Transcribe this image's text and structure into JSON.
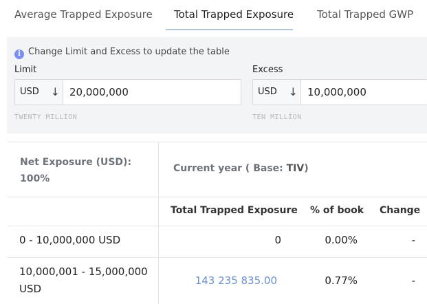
{
  "tabs": [
    {
      "label": "Average Trapped Exposure",
      "active": false
    },
    {
      "label": "Total Trapped Exposure",
      "active": true
    },
    {
      "label": "Total Trapped GWP",
      "active": false
    }
  ],
  "filters": {
    "info_text": "Change Limit and Excess to update the table",
    "info_icon": "info-icon",
    "limit": {
      "label": "Limit",
      "currency": "USD",
      "value": "20,000,000",
      "words": "TWENTY MILLION"
    },
    "excess": {
      "label": "Excess",
      "currency": "USD",
      "value": "10,000,000",
      "words": "TEN MILLION"
    }
  },
  "table": {
    "net_exposure_label": "Net Exposure (USD):",
    "net_exposure_pct": "100%",
    "current_year_prefix": "Current year ( Base: ",
    "current_year_base": "TIV",
    "current_year_suffix": ")",
    "columns": [
      "Total Trapped Exposure",
      "% of book",
      "Change"
    ],
    "rows": [
      {
        "band_line1": "0 - 10,000,000 USD",
        "band_line2": "",
        "total": "0",
        "pct": "0.00%",
        "change": "-"
      },
      {
        "band_line1": "10,000,001 - 15,000,000",
        "band_line2": "USD",
        "total": "143 235 835.00",
        "pct": "0.77%",
        "change": "-"
      }
    ]
  },
  "colors": {
    "accent": "#6a8fd0",
    "info_icon": "#7a8ff0",
    "panel_bg": "#f3f4f6"
  }
}
